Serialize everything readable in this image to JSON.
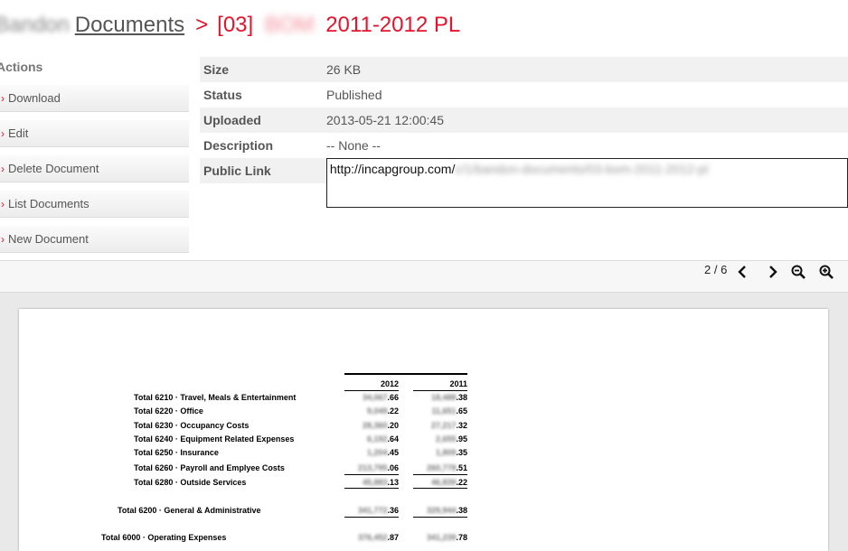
{
  "breadcrumb": {
    "blurred_owner": "Bandon",
    "documents_link": "Documents",
    "separator": ">",
    "doc_prefix": "[03]",
    "doc_blurred": "BOM",
    "doc_suffix": "2011-2012 PL"
  },
  "actions": {
    "title": "Actions",
    "items": [
      {
        "label": "Download"
      },
      {
        "label": "Edit"
      },
      {
        "label": "Delete Document"
      },
      {
        "label": "List Documents"
      },
      {
        "label": "New Document"
      }
    ]
  },
  "details": {
    "size_label": "Size",
    "size_value": "26 KB",
    "status_label": "Status",
    "status_value": "Published",
    "uploaded_label": "Uploaded",
    "uploaded_value": "2013-05-21 12:00:45",
    "description_label": "Description",
    "description_value": "-- None --",
    "public_link_label": "Public Link",
    "public_link_prefix": "http://incapgroup.com/",
    "public_link_blurred": "c/1/bandon-documents/03-bom-2011-2012-pl"
  },
  "viewer": {
    "page_indicator": "2 / 6",
    "icons": [
      "chevron-left-icon",
      "chevron-right-icon",
      "zoom-out-icon",
      "zoom-in-icon"
    ]
  },
  "document": {
    "col_2012": "2012",
    "col_2011": "2011",
    "rows": [
      {
        "label": "Total 6210 · Travel, Meals & Entertainment",
        "v2012_blur": "34,067",
        "v2012_tail": ".66",
        "v2011_blur": "18,488",
        "v2011_tail": ".38"
      },
      {
        "label": "Total 6220 · Office",
        "v2012_blur": "9,049",
        "v2012_tail": ".22",
        "v2011_blur": "11,651",
        "v2011_tail": ".65"
      },
      {
        "label": "Total 6230 · Occupancy Costs",
        "v2012_blur": "28,360",
        "v2012_tail": ".20",
        "v2011_blur": "27,217",
        "v2011_tail": ".32"
      },
      {
        "label": "Total 6240 · Equipment Related Expenses",
        "v2012_blur": "6,192",
        "v2012_tail": ".64",
        "v2011_blur": "2,655",
        "v2011_tail": ".95"
      },
      {
        "label": "Total 6250 · Insurance",
        "v2012_blur": "1,204",
        "v2012_tail": ".45",
        "v2011_blur": "1,809",
        "v2011_tail": ".35"
      },
      {
        "label": "Total 6260 · Payroll and Emplyee Costs",
        "v2012_blur": "213,795",
        "v2012_tail": ".06",
        "v2011_blur": "260,778",
        "v2011_tail": ".51"
      },
      {
        "label": "Total 6280 · Outside Services",
        "v2012_blur": "45,883",
        "v2012_tail": ".13",
        "v2011_blur": "46,839",
        "v2011_tail": ".22"
      }
    ],
    "subtotal": {
      "label": "Total 6200 · General & Administrative",
      "v2012_blur": "341,772",
      "v2012_tail": ".36",
      "v2011_blur": "329,944",
      "v2011_tail": ".38"
    },
    "total": {
      "label": "Total 6000 · Operating Expenses",
      "v2012_blur": "376,452",
      "v2012_tail": ".87",
      "v2011_blur": "341,239",
      "v2011_tail": ".78"
    }
  },
  "colors": {
    "accent": "#e5132c",
    "text": "#555555",
    "row_alt": "#f1f1f1"
  }
}
